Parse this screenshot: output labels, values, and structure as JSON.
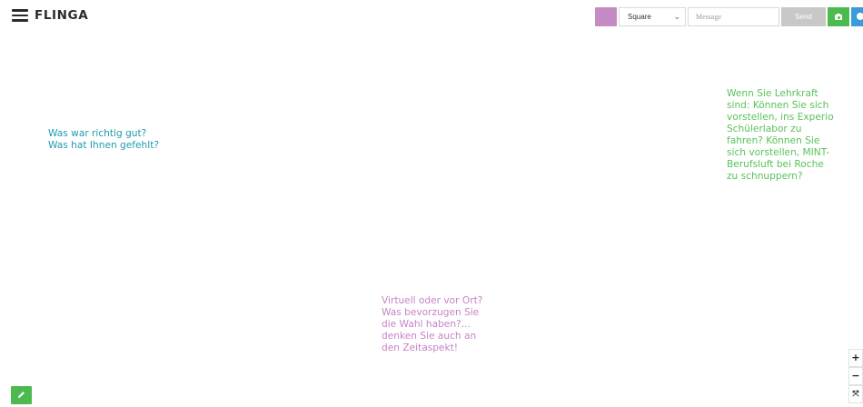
{
  "colors": {
    "brand_dark": "#2b2b2b",
    "swatch": "#c48bc4",
    "send_bg": "#c8c8c8",
    "green": "#4cba4f",
    "blue": "#3a9bd9",
    "note_teal": "#1e9bb0",
    "note_green": "#58c35a",
    "note_purple": "#c684c6"
  },
  "header": {
    "menu_icon": "hamburger-icon",
    "logo": "FLINGA",
    "shape_value": "Square",
    "shape_chevron": "⌄",
    "message_placeholder": "Message",
    "send_label": "Send",
    "camera_icon": "camera-icon",
    "info_icon": "info-icon"
  },
  "notes": [
    {
      "text": "Was war richtig gut?\nWas hat Ihnen gefehlt?",
      "color": "#1e9bb0"
    },
    {
      "text": "Wenn Sie Lehrkraft\nsind: Können Sie sich\nvorstellen, ins Experio\nSchülerlabor zu\nfahren? Können Sie\nsich vorstellen, MINT-\nBerufsluft bei Roche\nzu schnuppern?",
      "color": "#58c35a"
    },
    {
      "text": "Virtuell oder vor Ort?\nWas bevorzugen Sie\ndie Wahl haben?...\ndenken Sie auch an\nden Zeitaspekt!",
      "color": "#c684c6"
    }
  ],
  "tools": {
    "pencil_icon": "pencil-icon",
    "zoom_in": "+",
    "zoom_out": "−",
    "zoom_fit": "⤧"
  }
}
